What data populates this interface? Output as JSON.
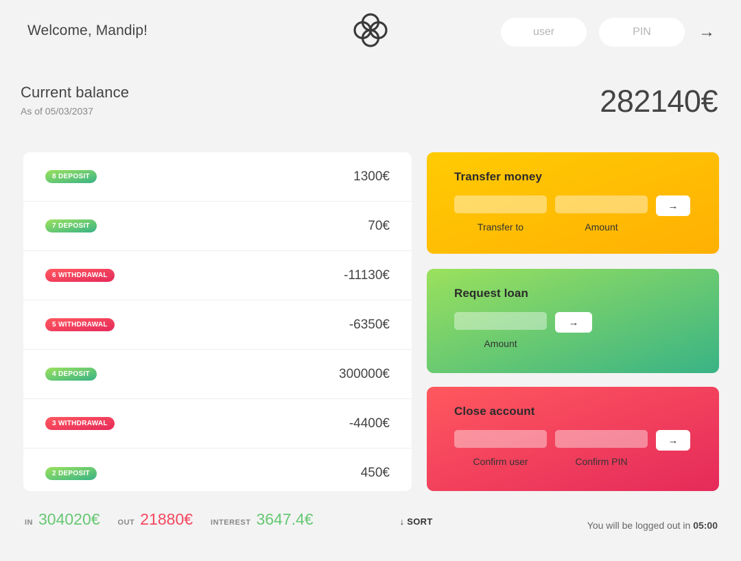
{
  "nav": {
    "welcome": "Welcome, Mandip!",
    "logo_name": "bankist-logo",
    "user_placeholder": "user",
    "user_value": "",
    "pin_placeholder": "PIN",
    "pin_value": "",
    "login_button_label": "→"
  },
  "balance": {
    "label": "Current balance",
    "date_prefix": "As of ",
    "date": "As of 05/03/2037",
    "value": "282140€"
  },
  "movements": [
    {
      "index": "8",
      "type": "DEPOSIT",
      "kind": "deposit",
      "label": "8 DEPOSIT",
      "value": "1300€"
    },
    {
      "index": "7",
      "type": "DEPOSIT",
      "kind": "deposit",
      "label": "7 DEPOSIT",
      "value": "70€"
    },
    {
      "index": "6",
      "type": "WITHDRAWAL",
      "kind": "withdrawal",
      "label": "6 WITHDRAWAL",
      "value": "-11130€"
    },
    {
      "index": "5",
      "type": "WITHDRAWAL",
      "kind": "withdrawal",
      "label": "5 WITHDRAWAL",
      "value": "-6350€"
    },
    {
      "index": "4",
      "type": "DEPOSIT",
      "kind": "deposit",
      "label": "4 DEPOSIT",
      "value": "300000€"
    },
    {
      "index": "3",
      "type": "WITHDRAWAL",
      "kind": "withdrawal",
      "label": "3 WITHDRAWAL",
      "value": "-4400€"
    },
    {
      "index": "2",
      "type": "DEPOSIT",
      "kind": "deposit",
      "label": "2 DEPOSIT",
      "value": "450€"
    }
  ],
  "operations": {
    "transfer": {
      "title": "Transfer money",
      "to_label": "Transfer to",
      "to_value": "",
      "amount_label": "Amount",
      "amount_value": "",
      "button_label": "→"
    },
    "loan": {
      "title": "Request loan",
      "amount_label": "Amount",
      "amount_value": "",
      "button_label": "→"
    },
    "close": {
      "title": "Close account",
      "user_label": "Confirm user",
      "user_value": "",
      "pin_label": "Confirm PIN",
      "pin_value": "",
      "button_label": "→"
    }
  },
  "summary": {
    "in_label": "IN",
    "in_value": "304020€",
    "out_label": "OUT",
    "out_value": "21880€",
    "interest_label": "INTEREST",
    "interest_value": "3647.4€",
    "sort_label": "↓ SORT",
    "logout_prefix": "You will be logged out in ",
    "logout_time": "05:00"
  },
  "colors": {
    "page_bg": "#f3f3f3",
    "text": "#444444",
    "deposit_from": "#39b385",
    "deposit_to": "#9be15d",
    "withdrawal_from": "#e52a5a",
    "withdrawal_to": "#ff585f",
    "transfer_from": "#ffb003",
    "transfer_to": "#ffcb03",
    "summary_in": "#66c873",
    "summary_out": "#f5465d"
  }
}
